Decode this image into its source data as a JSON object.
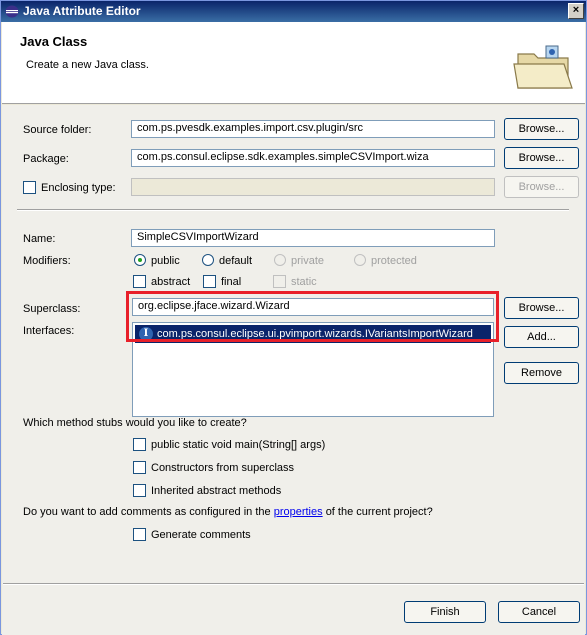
{
  "window": {
    "title": "Java Attribute Editor",
    "close_glyph": "×"
  },
  "banner": {
    "heading": "Java Class",
    "subtitle": "Create a new Java class.",
    "icon": "folder-icon"
  },
  "form": {
    "source_folder": {
      "label": "Source folder:",
      "value": "com.ps.pvesdk.examples.import.csv.plugin/src",
      "button": "Browse..."
    },
    "package": {
      "label": "Package:",
      "value": "com.ps.consul.eclipse.sdk.examples.simpleCSVImport.wiza",
      "button": "Browse..."
    },
    "enclosing_type": {
      "label": "Enclosing type:",
      "value": "",
      "button": "Browse..."
    },
    "name": {
      "label": "Name:",
      "value": "SimpleCSVImportWizard"
    },
    "modifiers": {
      "label": "Modifiers:",
      "radios": [
        "public",
        "default",
        "private",
        "protected"
      ],
      "checks": [
        "abstract",
        "final",
        "static"
      ]
    },
    "superclass": {
      "label": "Superclass:",
      "value": "org.eclipse.jface.wizard.Wizard",
      "button": "Browse..."
    },
    "interfaces": {
      "label": "Interfaces:",
      "selected_item": "com.ps.consul.eclipse.ui.pvimport.wizards.IVariantsImportWizard",
      "add_button": "Add...",
      "remove_button": "Remove"
    }
  },
  "stubs": {
    "question": "Which method stubs would you like to create?",
    "options": [
      "public static void main(String[] args)",
      "Constructors from superclass",
      "Inherited abstract methods"
    ]
  },
  "comments": {
    "question_prefix": "Do you want to add comments as configured in the",
    "link": "properties",
    "question_suffix": "of the current project?",
    "option": "Generate comments"
  },
  "footer": {
    "finish": "Finish",
    "cancel": "Cancel"
  },
  "colors": {
    "highlight_box": "#e8202a",
    "selection": "#0a246a"
  }
}
